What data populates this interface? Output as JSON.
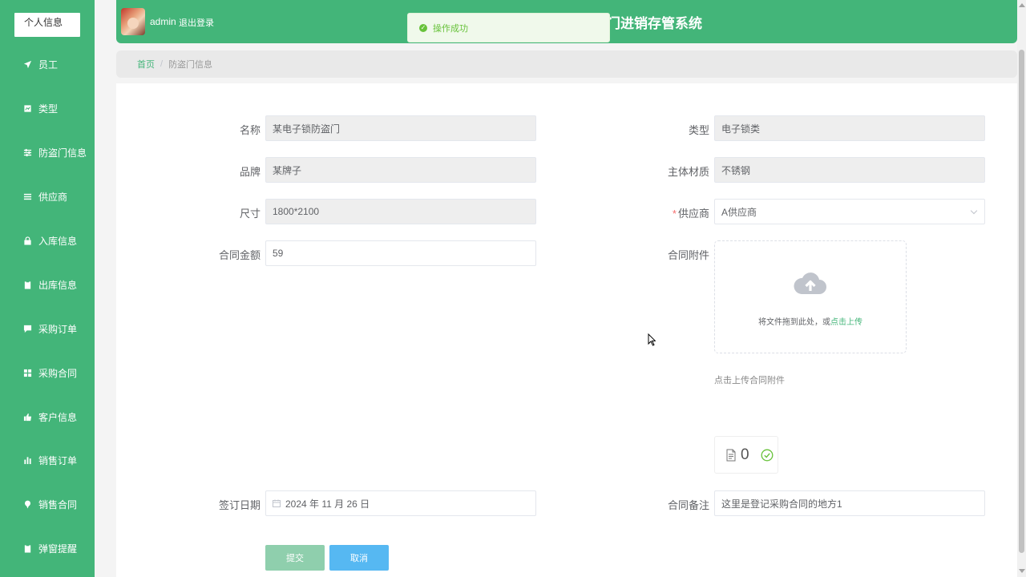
{
  "sidebar": {
    "profile_label": "个人信息",
    "items": [
      {
        "label": "员工",
        "icon": "paper-plane-icon"
      },
      {
        "label": "类型",
        "icon": "chart-box-icon"
      },
      {
        "label": "防盗门信息",
        "icon": "sliders-icon"
      },
      {
        "label": "供应商",
        "icon": "list-icon"
      },
      {
        "label": "入库信息",
        "icon": "lock-icon"
      },
      {
        "label": "出库信息",
        "icon": "clipboard-icon"
      },
      {
        "label": "采购订单",
        "icon": "chat-icon"
      },
      {
        "label": "采购合同",
        "icon": "grid-icon"
      },
      {
        "label": "客户信息",
        "icon": "thumb-icon"
      },
      {
        "label": "销售订单",
        "icon": "bar-chart-icon"
      },
      {
        "label": "销售合同",
        "icon": "pin-icon"
      },
      {
        "label": "弹窗提醒",
        "icon": "clipboard-icon"
      }
    ]
  },
  "header": {
    "username": "admin",
    "logout_label": "退出登录",
    "system_title": "门进销存管系统"
  },
  "toast": {
    "message": "操作成功"
  },
  "breadcrumb": {
    "home": "首页",
    "separator": "/",
    "current": "防盗门信息"
  },
  "form": {
    "name_label": "名称",
    "name_value": "某电子锁防盗门",
    "type_label": "类型",
    "type_value": "电子锁类",
    "brand_label": "品牌",
    "brand_value": "某牌子",
    "material_label": "主体材质",
    "material_value": "不锈钢",
    "size_label": "尺寸",
    "size_value": "1800*2100",
    "supplier_required": "*",
    "supplier_label": "供应商",
    "supplier_value": "A供应商",
    "amount_label": "合同金额",
    "amount_value": "59",
    "attachment_label": "合同附件",
    "upload_text": "将文件拖到此处，或",
    "upload_link": "点击上传",
    "upload_tip": "点击上传合同附件",
    "file_count": "0",
    "date_label": "签订日期",
    "date_value": "2024 年 11 月 26 日",
    "remark_label": "合同备注",
    "remark_value": "这里是登记采购合同的地方1",
    "submit_label": "提交",
    "cancel_label": "取消"
  },
  "colors": {
    "brand_green": "#43b579",
    "submit_button": "#8fcfad",
    "cancel_button": "#56b8f2",
    "success": "#67c23a"
  }
}
